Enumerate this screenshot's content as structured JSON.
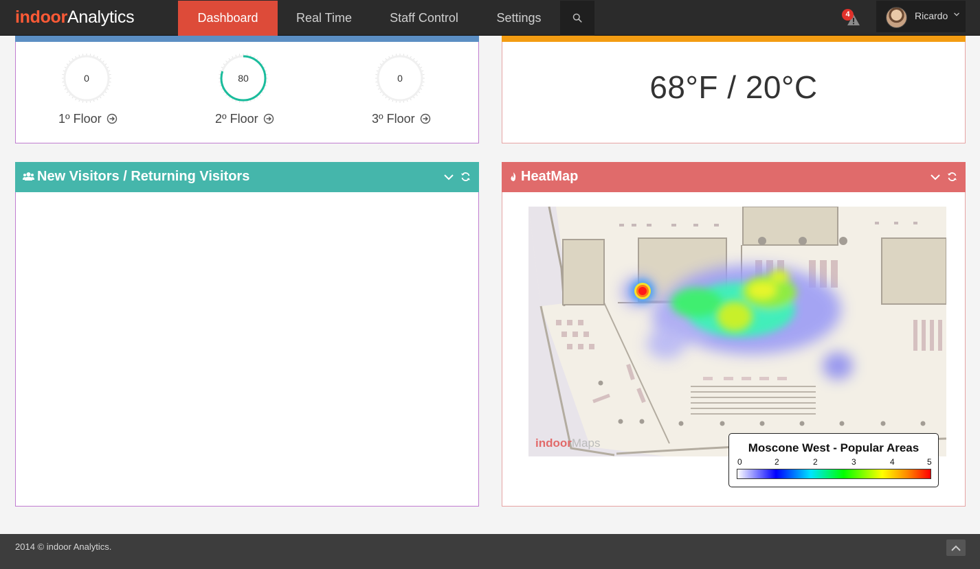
{
  "brand": {
    "part1": "indoor",
    "part2": "Analytics"
  },
  "nav": {
    "items": [
      {
        "label": "Dashboard",
        "active": true
      },
      {
        "label": "Real Time"
      },
      {
        "label": "Staff Control"
      },
      {
        "label": "Settings"
      }
    ],
    "search_icon": "search-icon",
    "alerts_count": "4",
    "user_name": "Ricardo"
  },
  "floors": [
    {
      "value": "0",
      "label": "1º Floor",
      "level": 0
    },
    {
      "value": "80",
      "label": "2º Floor",
      "level": 80
    },
    {
      "value": "0",
      "label": "3º Floor",
      "level": 0
    }
  ],
  "temperature": {
    "value": "68°F / 20°C"
  },
  "panels": {
    "visitors": {
      "title": "New Visitors / Returning Visitors",
      "icon": "users-icon"
    },
    "heatmap": {
      "title": "HeatMap",
      "icon": "fire-icon"
    }
  },
  "heatmap": {
    "watermark_part1": "indoor",
    "watermark_part2": "Maps",
    "legend_title": "Moscone West - Popular Areas",
    "legend_ticks": [
      "0",
      "2",
      "2",
      "3",
      "4",
      "5"
    ]
  },
  "colors": {
    "accent": "#dd4b39",
    "floors_strip": "#5b8ec3",
    "temp_strip": "#f39c12",
    "teal": "#45b6ab",
    "red": "#e06b6b",
    "gauge_active": "#1abc9c"
  },
  "footer": {
    "text": "2014 © indoor Analytics."
  }
}
